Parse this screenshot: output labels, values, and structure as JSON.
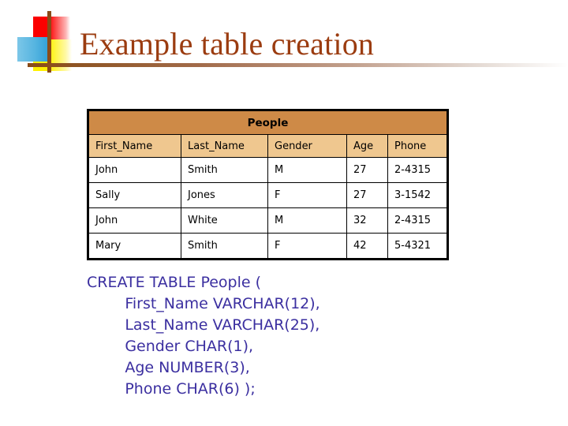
{
  "slide": {
    "title": "Example table creation",
    "decoration": {
      "red_square": "red-gradient-square",
      "blue_square": "blue-gradient-square",
      "yellow_square": "yellow-gradient-square",
      "vertical_rule": "brown-vertical-rule",
      "horizontal_rule": "brown-fading-horizontal-rule",
      "colors": {
        "red": "#fb0000",
        "blue": "#55b4e0",
        "yellow": "#fff100",
        "brown": "#8a4b18",
        "title": "#9b3c10"
      }
    }
  },
  "table": {
    "caption": "People",
    "colors": {
      "caption_bg": "#ce8a47",
      "header_bg": "#efc78f",
      "cell_bg": "#ffffff",
      "border": "#000000"
    },
    "columns": [
      "First_Name",
      "Last_Name",
      "Gender",
      "Age",
      "Phone"
    ],
    "rows": [
      [
        "John",
        "Smith",
        "M",
        "27",
        "2-4315"
      ],
      [
        "Sally",
        "Jones",
        "F",
        "27",
        "3-1542"
      ],
      [
        "John",
        "White",
        "M",
        "32",
        "2-4315"
      ],
      [
        "Mary",
        "Smith",
        "F",
        "42",
        "5-4321"
      ]
    ]
  },
  "sql": {
    "color": "#3b2fa0",
    "lines": [
      "CREATE TABLE People (",
      "        First_Name VARCHAR(12),",
      "        Last_Name VARCHAR(25),",
      "        Gender CHAR(1),",
      "        Age NUMBER(3),",
      "        Phone CHAR(6) );"
    ],
    "text": "CREATE TABLE People (\n        First_Name VARCHAR(12),\n        Last_Name VARCHAR(25),\n        Gender CHAR(1),\n        Age NUMBER(3),\n        Phone CHAR(6) );"
  }
}
